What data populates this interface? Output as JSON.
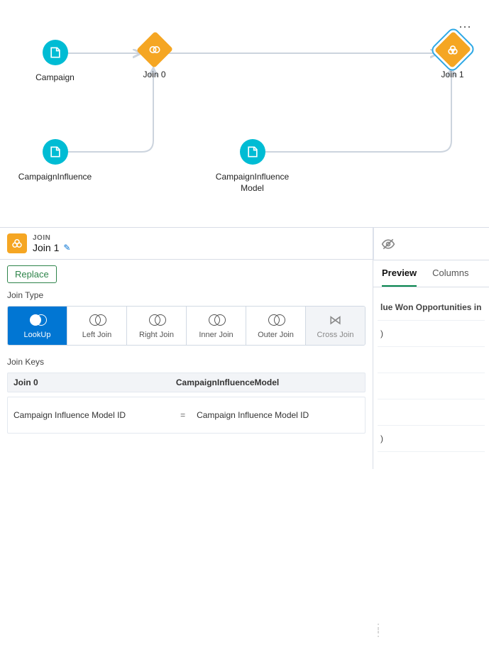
{
  "canvas": {
    "nodes": [
      {
        "key": "campaign",
        "label": "Campaign",
        "type": "source"
      },
      {
        "key": "campaign_influence",
        "label": "CampaignInfluence",
        "type": "source"
      },
      {
        "key": "campaign_influence_model",
        "label": "CampaignInfluence\nModel",
        "type": "source"
      },
      {
        "key": "join0",
        "label": "Join 0",
        "type": "join"
      },
      {
        "key": "join1",
        "label": "Join 1",
        "type": "join",
        "selected": true
      }
    ]
  },
  "panel": {
    "header": {
      "type": "JOIN",
      "name": "Join 1"
    },
    "replace_label": "Replace",
    "join_type_label": "Join Type",
    "join_types": [
      {
        "key": "lookup",
        "label": "LookUp",
        "active": true
      },
      {
        "key": "left",
        "label": "Left Join"
      },
      {
        "key": "right",
        "label": "Right Join"
      },
      {
        "key": "inner",
        "label": "Inner Join"
      },
      {
        "key": "outer",
        "label": "Outer Join"
      },
      {
        "key": "cross",
        "label": "Cross Join",
        "disabled": true
      }
    ],
    "join_keys_label": "Join Keys",
    "keys_header": {
      "left": "Join 0",
      "right": "CampaignInfluenceModel"
    },
    "keys_row": {
      "left": "Campaign Influence Model ID",
      "op": "=",
      "right": "Campaign Influence Model ID"
    }
  },
  "right": {
    "tabs": [
      {
        "key": "preview",
        "label": "Preview",
        "active": true
      },
      {
        "key": "columns",
        "label": "Columns"
      }
    ],
    "col_header_fragment": "lue Won Opportunities in",
    "cell_fragment": ")"
  }
}
